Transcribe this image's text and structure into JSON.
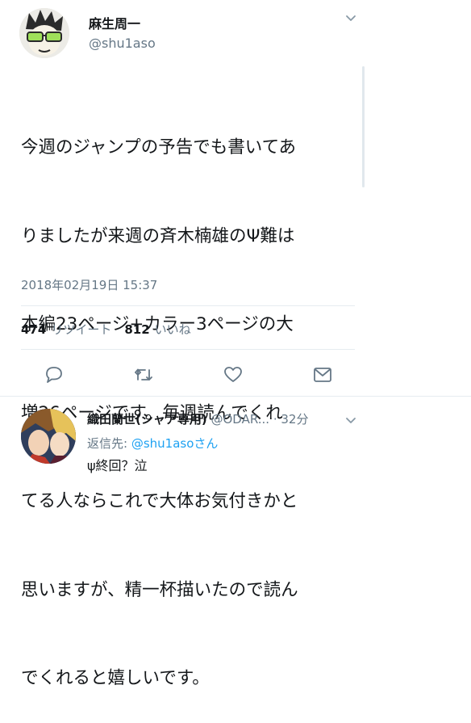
{
  "tweet": {
    "author_name": "麻生周一",
    "author_handle": "@shu1aso",
    "text": "今週のジャンプの予告でも書いてありましたが来週の斉木楠雄のΨ難は本編23ページ+カラー3ページの大増26ページです。毎週読んでくれてる人ならこれで大体お気付きかと思いますが、精一杯描いたので読んでくれると嬉しいです。",
    "lines": [
      "今週のジャンプの予告でも書いてあ",
      "りましたが来週の斉木楠雄のΨ難は",
      "本編23ページ+カラー3ページの大",
      "増26ページです。毎週読んでくれ",
      "てる人ならこれで大体お気付きかと",
      "思いますが、精一杯描いたので読ん",
      "でくれると嬉しいです。"
    ],
    "timestamp": "2018年02月19日 15:37",
    "retweet_count": "474",
    "retweet_label": "リツイート",
    "like_count": "812",
    "like_label": "いいね"
  },
  "actions": [
    "reply-icon",
    "retweet-icon",
    "like-icon",
    "share-icon"
  ],
  "reply": {
    "author_name": "織田蘭世(シャア専用)",
    "author_handle": "@ODAR...",
    "time": "· 32分",
    "reply_to_label": "返信先: ",
    "reply_to_handle": "@shu1asoさん",
    "text": "ψ終回？泣"
  },
  "colors": {
    "text": "#14171a",
    "secondary": "#657786",
    "link": "#1da1f2",
    "divider": "#e6ecf0"
  }
}
